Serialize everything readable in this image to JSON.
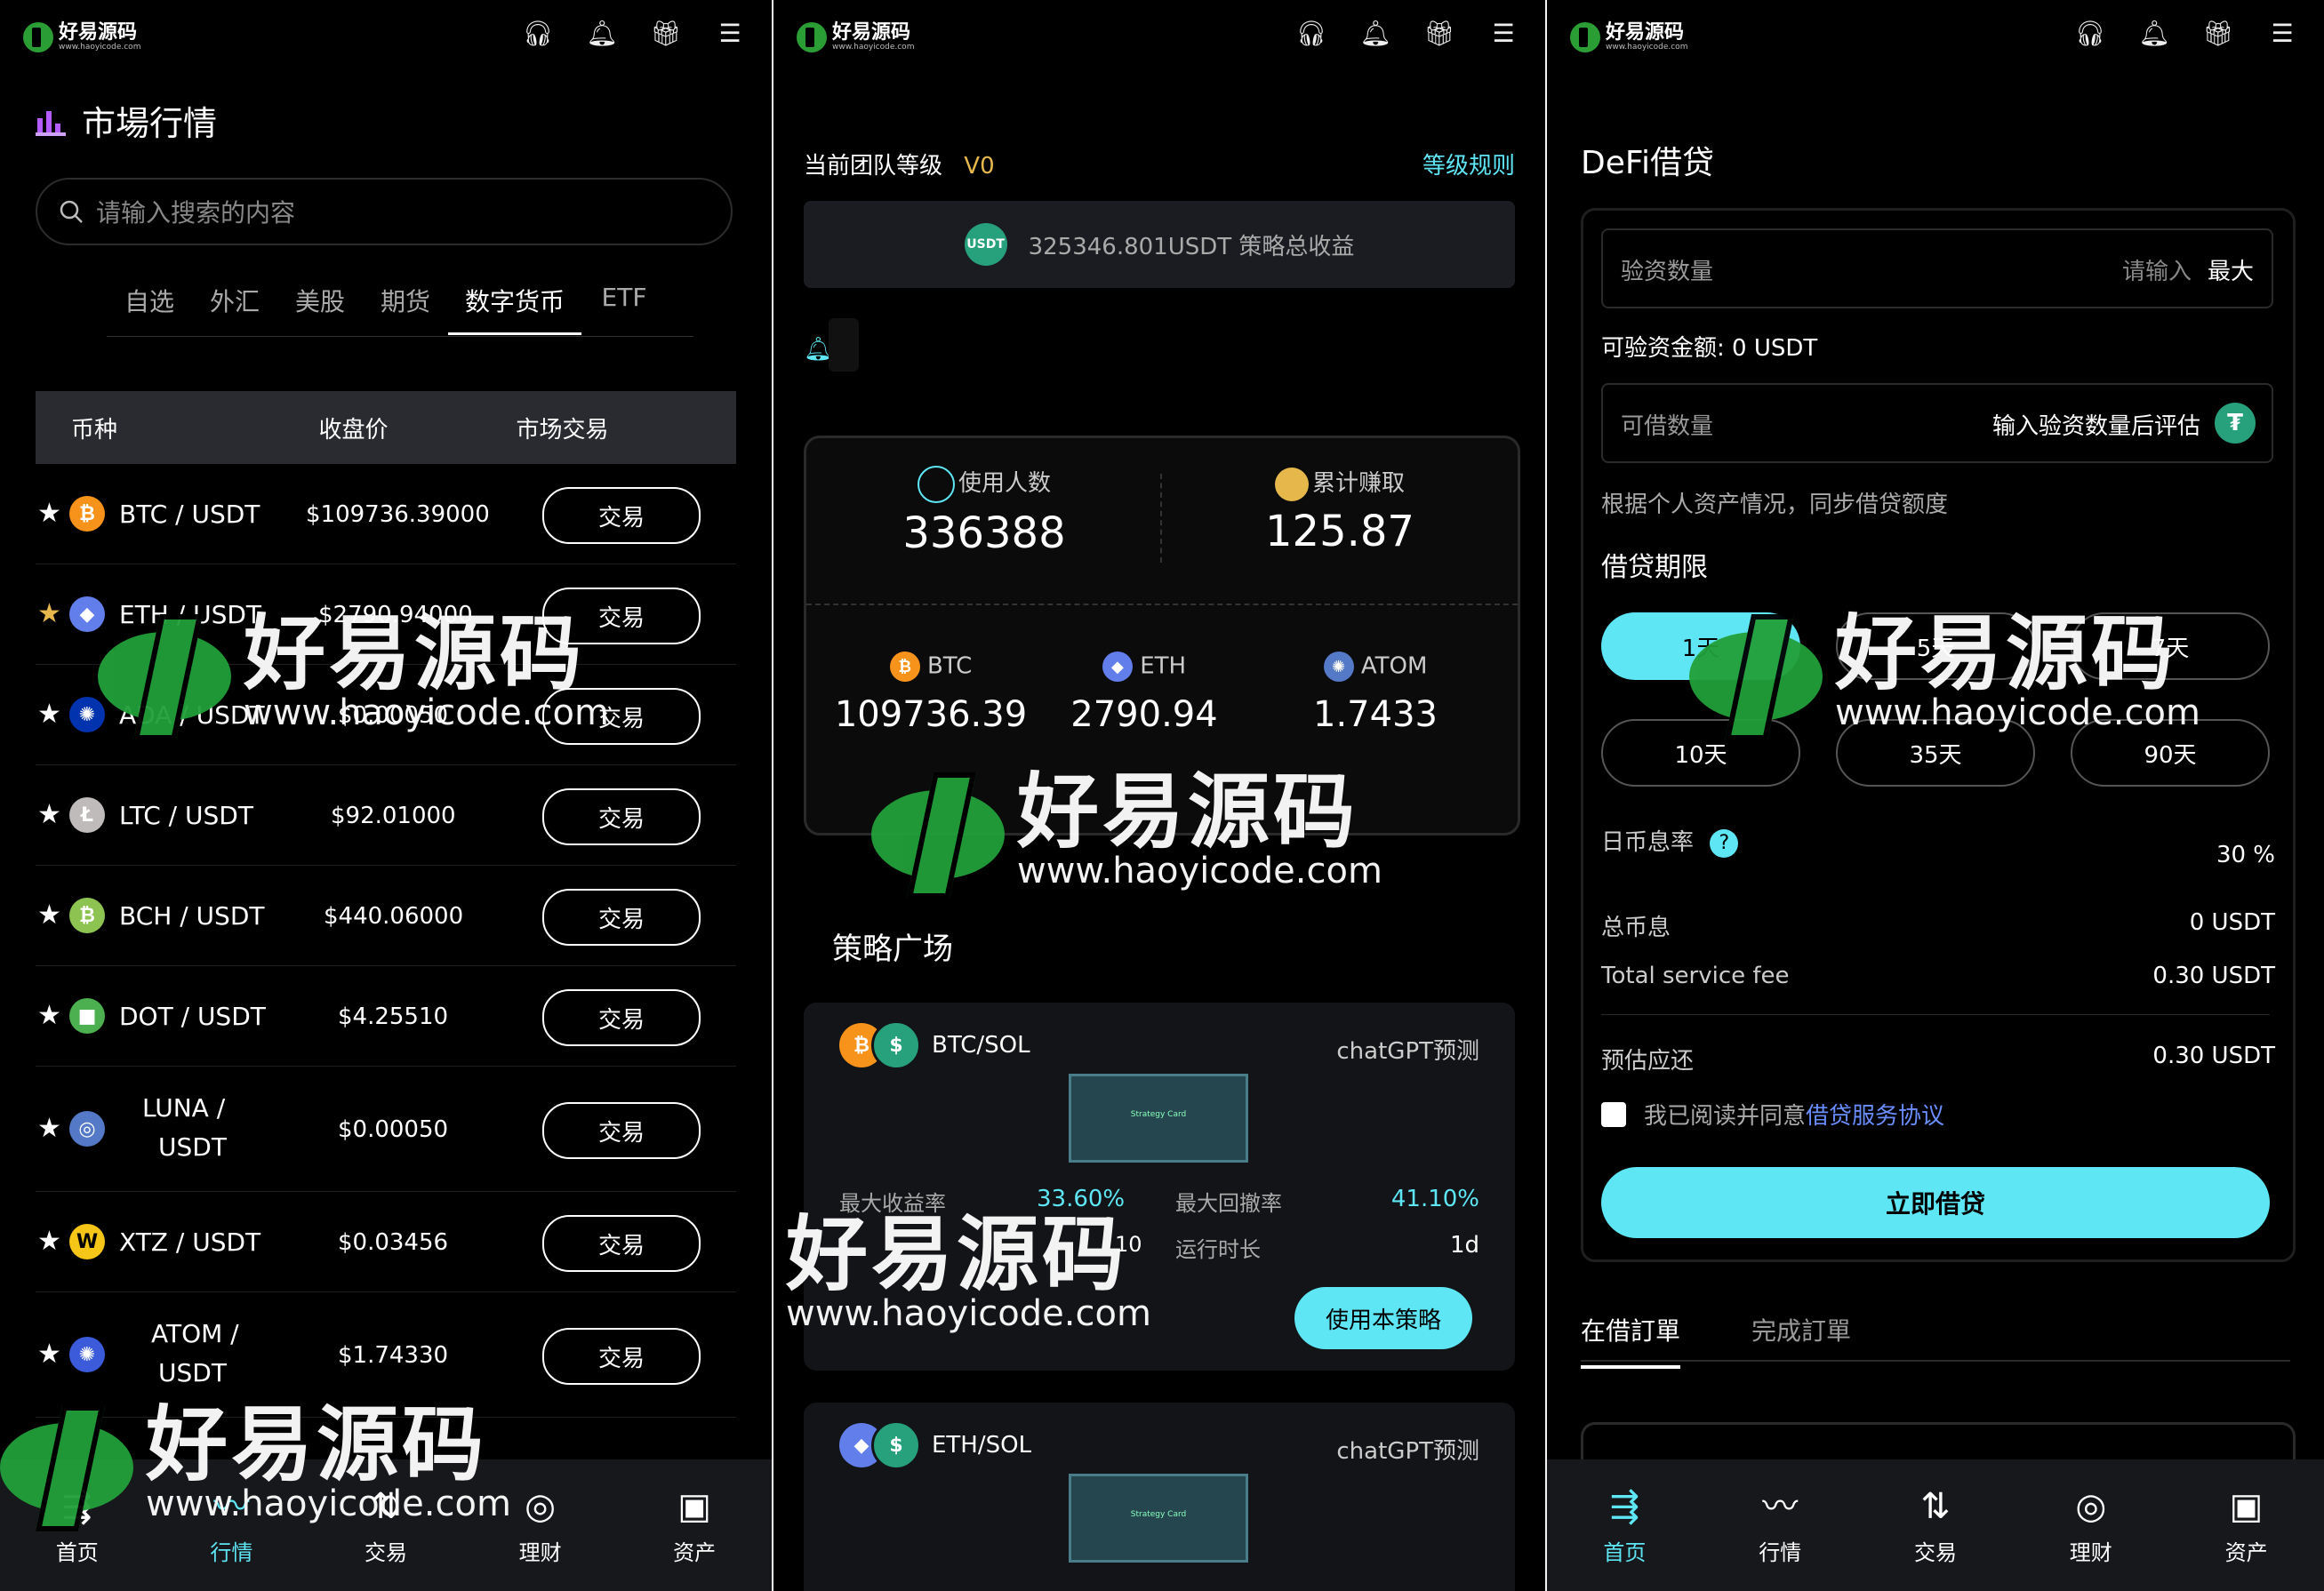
{
  "brand": {
    "logo_text": "好易源码",
    "logo_sub": "www.haoyicode.com"
  },
  "watermark": {
    "title": "好易源码",
    "url": "www.haoyicode.com"
  },
  "icons": [
    "headset-icon",
    "bell-icon",
    "gift-icon",
    "menu-icon"
  ],
  "colors": {
    "accent": "#5ee6f5",
    "background": "#000000",
    "card": "#131417"
  },
  "market": {
    "title": "市場行情",
    "search_placeholder": "请输入搜索的内容",
    "tabs": [
      "自选",
      "外汇",
      "美股",
      "期货",
      "数字货币",
      "ETF"
    ],
    "active_tab": "数字货币",
    "headers": [
      "币种",
      "收盘价",
      "市场交易"
    ],
    "trade_label": "交易",
    "rows": [
      {
        "pair": "BTC / USDT",
        "price": "$109736.39000",
        "coin": "btc",
        "color": "#f7931a",
        "glyph": "₿",
        "starred": false
      },
      {
        "pair": "ETH / USDT",
        "price": "$2790.94000",
        "coin": "eth",
        "color": "#627eea",
        "glyph": "◆",
        "starred": true
      },
      {
        "pair": "ADA / USDT",
        "price": "$0.00050",
        "coin": "ada",
        "color": "#0033ad",
        "glyph": "✺",
        "starred": false
      },
      {
        "pair": "LTC / USDT",
        "price": "$92.01000",
        "coin": "ltc",
        "color": "#bfbbbb",
        "glyph": "Ł",
        "starred": false
      },
      {
        "pair": "BCH / USDT",
        "price": "$440.06000",
        "coin": "bch",
        "color": "#8dc351",
        "glyph": "₿",
        "starred": false
      },
      {
        "pair": "DOT / USDT",
        "price": "$4.25510",
        "coin": "dot",
        "color": "#4caf50",
        "glyph": "■",
        "starred": false
      },
      {
        "pair_l1": "LUNA /",
        "pair_l2": "USDT",
        "price": "$0.00050",
        "coin": "luna",
        "color": "#5479c6",
        "glyph": "◎",
        "starred": false
      },
      {
        "pair": "XTZ / USDT",
        "price": "$0.03456",
        "coin": "xtz",
        "color": "#f5c518",
        "glyph": "W",
        "starred": false
      },
      {
        "pair_l1": "ATOM /",
        "pair_l2": "USDT",
        "price": "$1.74330",
        "coin": "atom",
        "color": "#3b5bdb",
        "glyph": "✺",
        "starred": false
      }
    ]
  },
  "strategy": {
    "level_label": "当前团队等级",
    "level_value": "V0",
    "level_rules": "等级规则",
    "usdt_badge": "USDT",
    "total_text": "325346.801USDT 策略总收益",
    "users_label": "使用人数",
    "users_value": "336388",
    "earned_label": "累计赚取",
    "earned_value": "125.87",
    "coins": [
      {
        "name": "BTC",
        "value": "109736.39",
        "color": "#f7931a",
        "glyph": "₿"
      },
      {
        "name": "ETH",
        "value": "2790.94",
        "color": "#627eea",
        "glyph": "◆"
      },
      {
        "name": "ATOM",
        "value": "1.7433",
        "color": "#5479c6",
        "glyph": "✺"
      }
    ],
    "plaza_title": "策略广场",
    "card1": {
      "pair": "BTC/SOL",
      "source": "chatGPT预测",
      "image_caption": "Strategy Card",
      "max_yield_label": "最大收益率",
      "max_yield_value": "33.60%",
      "max_drawdown_label": "最大回撤率",
      "max_drawdown_value": "41.10%",
      "partial_value": "10",
      "runtime_label": "运行时长",
      "runtime_value": "1d",
      "use_button": "使用本策略"
    },
    "card2": {
      "pair": "ETH/SOL",
      "source": "chatGPT预测",
      "image_caption": "Strategy Card"
    }
  },
  "defi": {
    "title": "DeFi借贷",
    "pledge_label": "验资数量",
    "pledge_placeholder": "请输入",
    "pledge_max": "最大",
    "available_text": "可验资金额: 0 USDT",
    "borrow_label": "可借数量",
    "borrow_hint": "输入验资数量后评估",
    "note": "根据个人资产情况，同步借贷额度",
    "term_title": "借贷期限",
    "terms_row1": [
      "1天",
      "5天",
      "7天"
    ],
    "terms_row2": [
      "10天",
      "35天",
      "90天"
    ],
    "rate_label": "日币息率",
    "rate_value": "30 %",
    "total_interest_label": "总币息",
    "total_interest_value": "0 USDT",
    "service_fee_label": "Total service fee",
    "service_fee_value": "0.30 USDT",
    "estimated_label": "预估应还",
    "estimated_value": "0.30 USDT",
    "agree_prefix": "我已阅读并同意",
    "agree_link": "借贷服务协议",
    "submit": "立即借贷",
    "order_tabs": [
      "在借訂單",
      "完成訂單"
    ]
  },
  "nav": {
    "items": [
      "首页",
      "行情",
      "交易",
      "理财",
      "资产"
    ]
  }
}
